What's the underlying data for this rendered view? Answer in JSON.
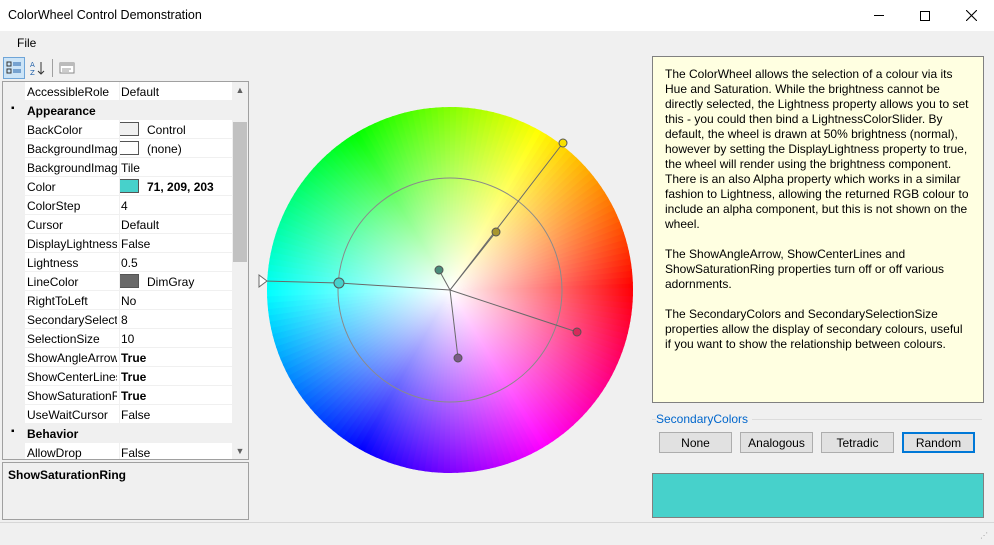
{
  "window": {
    "title": "ColorWheel Control Demonstration",
    "minimize_icon": "minimize-icon",
    "maximize_icon": "maximize-icon",
    "close_icon": "close-icon"
  },
  "menu": {
    "file": "File"
  },
  "toolbar": {
    "categorized_icon": "categorized-icon",
    "alphabetical_icon": "alphabetical-sort-icon",
    "property_pages_icon": "property-pages-icon"
  },
  "property_grid": {
    "rows": [
      {
        "kind": "prop",
        "name": "AccessibleRole",
        "value": "Default"
      },
      {
        "kind": "cat",
        "name": "Appearance"
      },
      {
        "kind": "prop",
        "name": "BackColor",
        "value": "Control",
        "swatch": "#f0f0f0"
      },
      {
        "kind": "prop",
        "name": "BackgroundImage",
        "value": "(none)",
        "swatch": "#ffffff"
      },
      {
        "kind": "prop",
        "name": "BackgroundImageLayout",
        "value": "Tile"
      },
      {
        "kind": "prop",
        "name": "Color",
        "value": "71, 209, 203",
        "swatch": "#47d1cb",
        "bold": true
      },
      {
        "kind": "prop",
        "name": "ColorStep",
        "value": "4"
      },
      {
        "kind": "prop",
        "name": "Cursor",
        "value": "Default"
      },
      {
        "kind": "prop",
        "name": "DisplayLightness",
        "value": "False"
      },
      {
        "kind": "prop",
        "name": "Lightness",
        "value": "0.5"
      },
      {
        "kind": "prop",
        "name": "LineColor",
        "value": "DimGray",
        "swatch": "#696969"
      },
      {
        "kind": "prop",
        "name": "RightToLeft",
        "value": "No"
      },
      {
        "kind": "prop",
        "name": "SecondarySelectionSize",
        "value": "8"
      },
      {
        "kind": "prop",
        "name": "SelectionSize",
        "value": "10"
      },
      {
        "kind": "prop",
        "name": "ShowAngleArrow",
        "value": "True",
        "bold": true
      },
      {
        "kind": "prop",
        "name": "ShowCenterLines",
        "value": "True",
        "bold": true
      },
      {
        "kind": "prop",
        "name": "ShowSaturationRing",
        "value": "True",
        "bold": true
      },
      {
        "kind": "prop",
        "name": "UseWaitCursor",
        "value": "False"
      },
      {
        "kind": "cat",
        "name": "Behavior"
      },
      {
        "kind": "prop",
        "name": "AllowDrop",
        "value": "False"
      }
    ],
    "description_title": "ShowSaturationRing"
  },
  "info": {
    "p1": "The ColorWheel allows the selection of a colour via its Hue and Saturation. While the brightness cannot be directly selected, the Lightness property allows you to set this - you could then bind a LightnessColorSlider. By default, the wheel is drawn at 50% brightness (normal), however by setting the DisplayLightness property to true, the wheel will render using the brightness component. There is an also Alpha property which works in a similar fashion to Lightness, allowing the returned RGB colour to include an alpha component, but this is not shown on the wheel.",
    "p2": "The ShowAngleArrow, ShowCenterLines and ShowSaturationRing properties turn off or off various adornments.",
    "p3": "The SecondaryColors and SecondarySelectionSize properties allow the display of secondary colours, useful if you want to show the relationship between colours."
  },
  "secondary": {
    "label": "SecondaryColors",
    "buttons": {
      "none": "None",
      "analogous": "Analogous",
      "tetradic": "Tetradic",
      "random": "Random"
    }
  },
  "selected_color": "#47d1cb",
  "wheel": {
    "selection": {
      "color": "#47d1cb"
    },
    "secondary_markers": [
      {
        "color": "#f7e000"
      },
      {
        "color": "#a8962e"
      },
      {
        "color": "#d62a5a"
      },
      {
        "color": "#7a5b86"
      },
      {
        "color": "#4a8c7a"
      }
    ]
  }
}
